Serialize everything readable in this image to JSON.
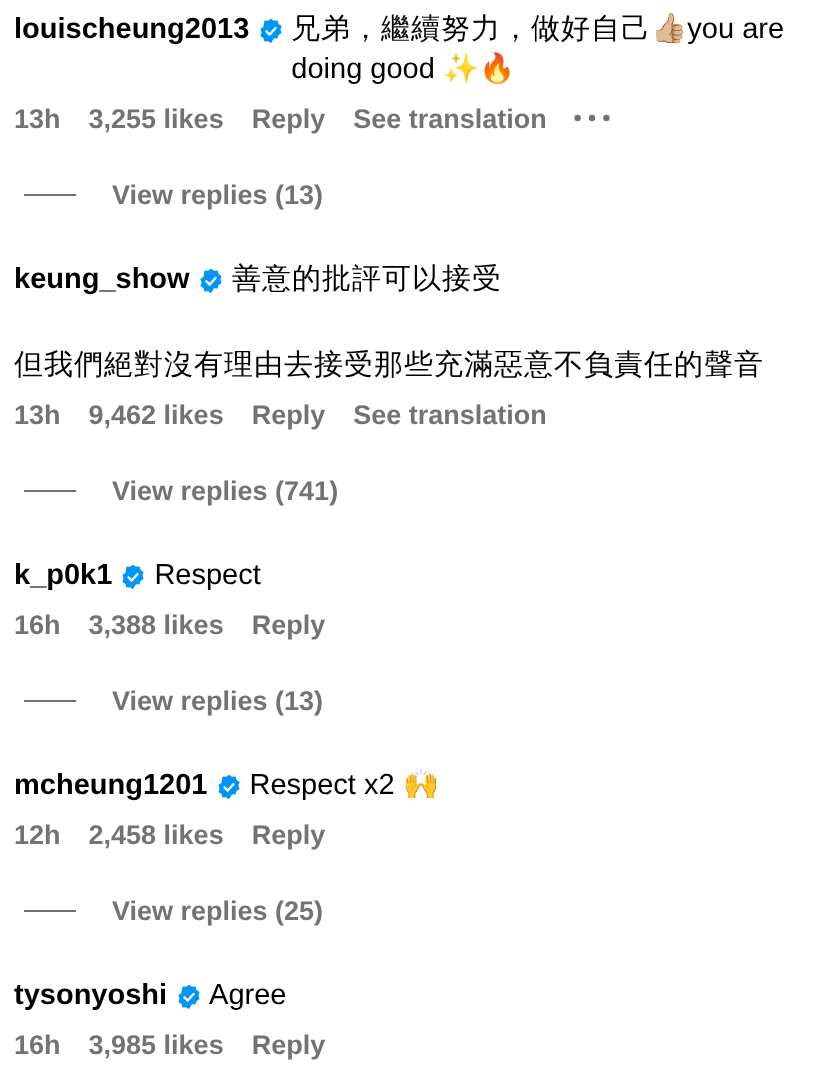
{
  "comments": [
    {
      "username": "louischeung2013",
      "verified": true,
      "paragraphs": [
        "兄弟，繼續努力，做好自己👍🏼you are doing good ✨🔥"
      ],
      "time": "13h",
      "likes": "3,255 likes",
      "reply": "Reply",
      "translation": "See translation",
      "more": true,
      "view_replies": "View replies (13)"
    },
    {
      "username": "keung_show",
      "verified": true,
      "paragraphs": [
        "善意的批評可以接受",
        "但我們絕對沒有理由去接受那些充滿惡意不負責任的聲音"
      ],
      "time": "13h",
      "likes": "9,462 likes",
      "reply": "Reply",
      "translation": "See translation",
      "view_replies": "View replies (741)"
    },
    {
      "username": "k_p0k1",
      "verified": true,
      "paragraphs": [
        "Respect"
      ],
      "time": "16h",
      "likes": "3,388 likes",
      "reply": "Reply",
      "view_replies": "View replies (13)"
    },
    {
      "username": "mcheung1201",
      "verified": true,
      "paragraphs": [
        "Respect x2 🙌"
      ],
      "time": "12h",
      "likes": "2,458 likes",
      "reply": "Reply",
      "view_replies": "View replies (25)"
    },
    {
      "username": "tysonyoshi",
      "verified": true,
      "paragraphs": [
        "Agree"
      ],
      "time": "16h",
      "likes": "3,985 likes",
      "reply": "Reply"
    }
  ]
}
